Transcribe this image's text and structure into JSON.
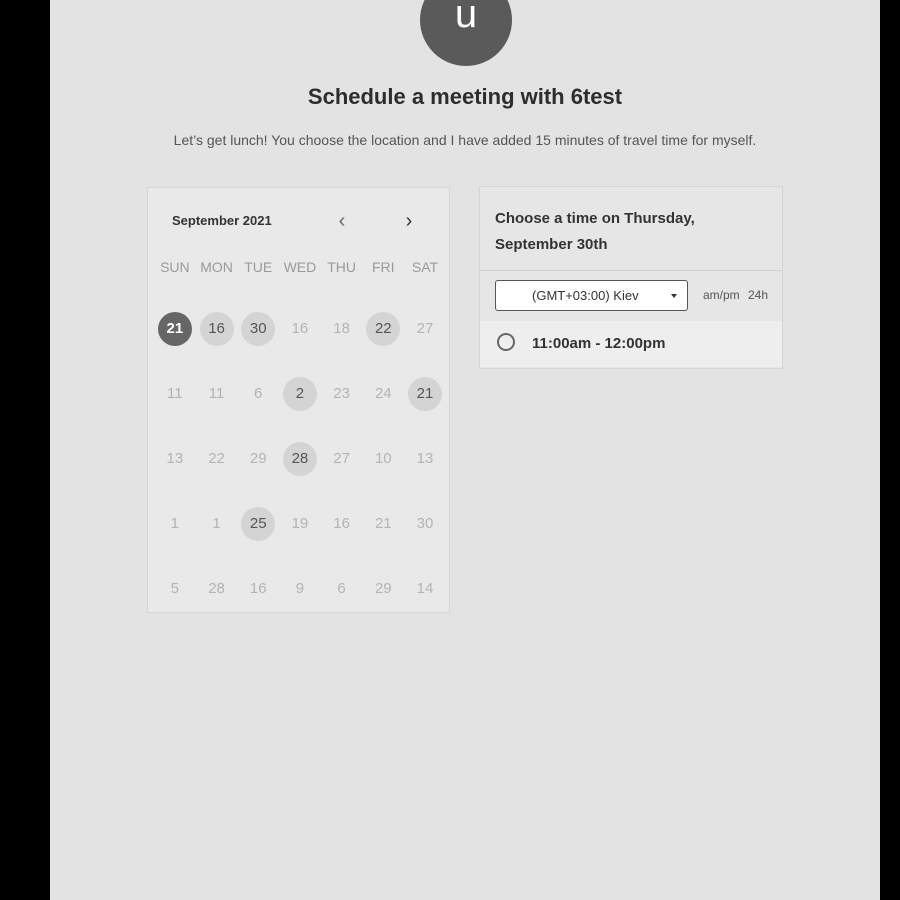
{
  "header": {
    "avatar_letter": "u",
    "title": "Schedule a meeting with 6test",
    "description": "Let’s get lunch! You choose the location and I have added 15 minutes of travel time for myself."
  },
  "calendar": {
    "month_label": "September 2021",
    "prev_icon": "‹",
    "next_icon": "›",
    "weekdays": [
      "SUN",
      "MON",
      "TUE",
      "WED",
      "THU",
      "FRI",
      "SAT"
    ],
    "days": [
      {
        "label": "21",
        "state": "selected"
      },
      {
        "label": "16",
        "state": "available"
      },
      {
        "label": "30",
        "state": "available"
      },
      {
        "label": "16",
        "state": "disabled"
      },
      {
        "label": "18",
        "state": "disabled"
      },
      {
        "label": "22",
        "state": "available"
      },
      {
        "label": "27",
        "state": "disabled"
      },
      {
        "label": "11",
        "state": "disabled"
      },
      {
        "label": "11",
        "state": "disabled"
      },
      {
        "label": "6",
        "state": "disabled"
      },
      {
        "label": "2",
        "state": "available"
      },
      {
        "label": "23",
        "state": "disabled"
      },
      {
        "label": "24",
        "state": "disabled"
      },
      {
        "label": "21",
        "state": "available"
      },
      {
        "label": "13",
        "state": "disabled"
      },
      {
        "label": "22",
        "state": "disabled"
      },
      {
        "label": "29",
        "state": "disabled"
      },
      {
        "label": "28",
        "state": "available"
      },
      {
        "label": "27",
        "state": "disabled"
      },
      {
        "label": "10",
        "state": "disabled"
      },
      {
        "label": "13",
        "state": "disabled"
      },
      {
        "label": "1",
        "state": "disabled"
      },
      {
        "label": "1",
        "state": "disabled"
      },
      {
        "label": "25",
        "state": "available"
      },
      {
        "label": "19",
        "state": "disabled"
      },
      {
        "label": "16",
        "state": "disabled"
      },
      {
        "label": "21",
        "state": "disabled"
      },
      {
        "label": "30",
        "state": "disabled"
      },
      {
        "label": "5",
        "state": "disabled"
      },
      {
        "label": "28",
        "state": "disabled"
      },
      {
        "label": "16",
        "state": "disabled"
      },
      {
        "label": "9",
        "state": "disabled"
      },
      {
        "label": "6",
        "state": "disabled"
      },
      {
        "label": "29",
        "state": "disabled"
      },
      {
        "label": "14",
        "state": "disabled"
      }
    ]
  },
  "times": {
    "heading": "Choose a time on Thursday, September 30th",
    "timezone": "(GMT+03:00) Kiev",
    "format_ampm": "am/pm",
    "format_24h": "24h",
    "slots": [
      {
        "label": "11:00am - 12:00pm"
      }
    ]
  }
}
